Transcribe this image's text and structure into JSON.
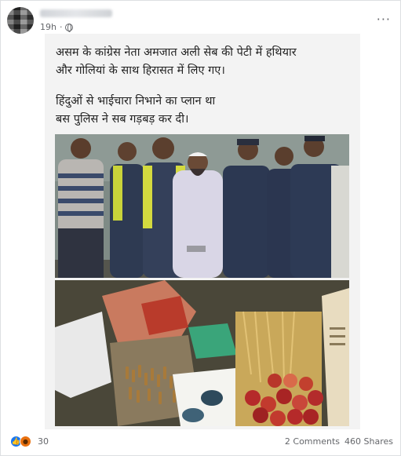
{
  "post": {
    "time": "19h",
    "more_glyph": "···",
    "image_text": {
      "line1": "असम के कांग्रेस नेता अमजात अली सेब की पेटी में हथियार",
      "line2": "और गोलियां के साथ   हिरासत में लिए गए।",
      "line3": "हिंदुओं से भाईचारा निभाने का प्लान था",
      "line4": "बस पुलिस ने सब गड़बड़ कर दी।"
    }
  },
  "footer": {
    "reaction_count": "30",
    "comments": "2 Comments",
    "shares": "460 Shares"
  },
  "icons": {
    "privacy": "globe-icon",
    "like": "like-icon",
    "angry": "angry-reaction-icon",
    "more": "more-options-icon"
  },
  "colors": {
    "like_blue": "#1877f2",
    "angry_orange": "#e9710f",
    "meta_gray": "#65676b"
  }
}
